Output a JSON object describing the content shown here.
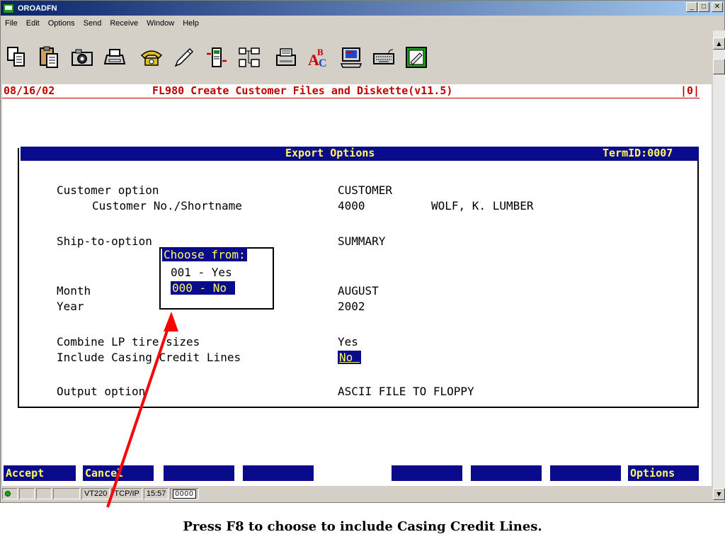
{
  "window": {
    "title": "OROADFN"
  },
  "menu": [
    "File",
    "Edit",
    "Options",
    "Send",
    "Receive",
    "Window",
    "Help"
  ],
  "toolbar_icons": [
    "copy-icon",
    "paste-icon",
    "camera-icon",
    "print-icon",
    "phone-icon",
    "pen-icon",
    "transfer-icon",
    "hierarchy-icon",
    "printer-icon",
    "spellcheck-icon",
    "terminal-icon",
    "keyboard-icon",
    "notepad-icon"
  ],
  "header": {
    "date": "08/16/02",
    "title": "FL980 Create Customer Files and Diskette(v11.5)",
    "count": "|0|"
  },
  "panel": {
    "title": "Export Options",
    "term": "TermID:0007"
  },
  "fields": {
    "customer_option_label": "Customer option",
    "customer_option_value": "CUSTOMER",
    "customer_no_label": "Customer No./Shortname",
    "customer_no_value": "4000",
    "customer_name_value": "WOLF, K. LUMBER",
    "shipto_label": "Ship-to-option",
    "shipto_value": "SUMMARY",
    "month_label": "Month",
    "month_value": "AUGUST",
    "year_label": "Year",
    "year_value": "2002",
    "combine_label": "Combine LP tire sizes",
    "combine_value": "Yes",
    "casing_label": "Include Casing Credit Lines",
    "casing_value": "No ",
    "output_label": "Output option",
    "output_value": "ASCII FILE TO FLOPPY"
  },
  "popup": {
    "title": "Choose from:",
    "options": [
      "001 - Yes",
      "000 - No "
    ]
  },
  "fkeys": {
    "accept": "Accept",
    "cancel": "Cancel",
    "options": "Options"
  },
  "status": {
    "emulation": "VT220",
    "protocol": "TCP/IP",
    "time": "15:57",
    "code": "0000"
  },
  "caption": "Press F8 to choose to include Casing Credit Lines.",
  "colors": {
    "title_bar": "#0a246a",
    "header_text": "#c00000",
    "bar_bg": "#0a0a8c",
    "bar_text": "#ffff60",
    "arrow": "#ff0000"
  }
}
